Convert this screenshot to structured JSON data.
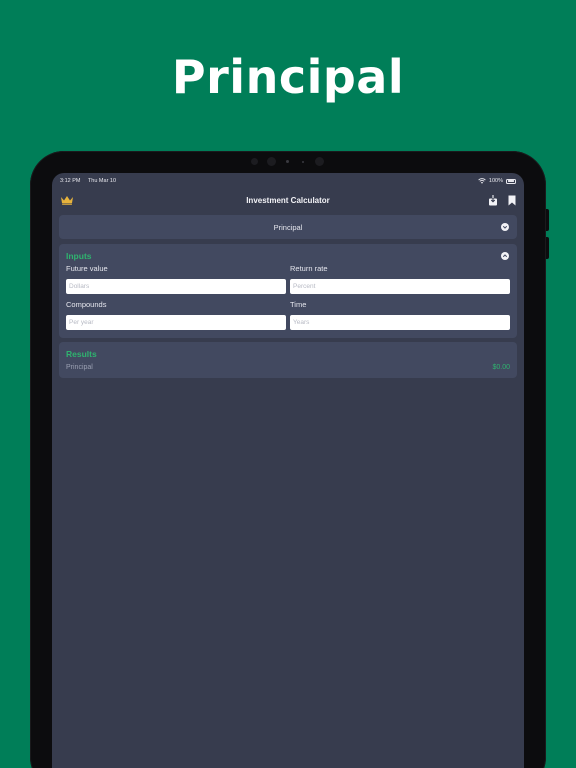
{
  "headline": "Principal",
  "status_bar": {
    "time": "3:12 PM",
    "date": "Thu Mar 10",
    "battery": "100%"
  },
  "nav": {
    "title": "Investment Calculator",
    "left_icon": "crown-icon",
    "right_icons": [
      "share-icon",
      "bookmark-icon"
    ]
  },
  "selector": {
    "label": "Principal"
  },
  "inputs": {
    "title": "Inputs",
    "fields": [
      {
        "label": "Future value",
        "placeholder": "Dollars"
      },
      {
        "label": "Return rate",
        "placeholder": "Percent"
      },
      {
        "label": "Compounds",
        "placeholder": "Per year"
      },
      {
        "label": "Time",
        "placeholder": "Years"
      }
    ]
  },
  "results": {
    "title": "Results",
    "rows": [
      {
        "label": "Principal",
        "value": "$0.00"
      }
    ]
  },
  "colors": {
    "background": "#007E58",
    "screen": "#373C4E",
    "panel": "#424960",
    "accent": "#2FB36F",
    "crown": "#E8B43C"
  }
}
